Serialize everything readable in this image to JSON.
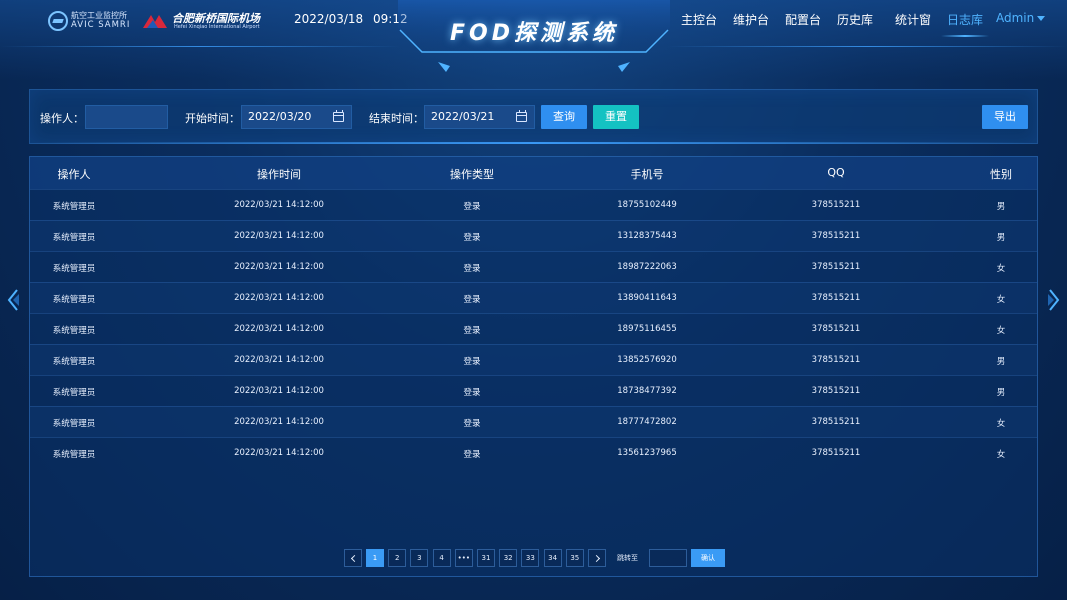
{
  "header": {
    "logo1": {
      "cn": "航空工业监控所",
      "en": "AVIC  SAMRI"
    },
    "logo2": {
      "cn": "合肥新桥国际机场",
      "en": "Hefei Xinqiao International Airport"
    },
    "date": "2022/03/18",
    "time": "09:12",
    "title": "FOD探测系统",
    "nav": [
      "主控台",
      "维护台",
      "配置台",
      "历史库",
      "统计窗",
      "日志库"
    ],
    "active_nav": "日志库",
    "user": "Admin"
  },
  "filter": {
    "operator_label": "操作人：",
    "operator_value": "",
    "start_label": "开始时间：",
    "start_value": "2022/03/20",
    "end_label": "结束时间：",
    "end_value": "2022/03/21",
    "query_label": "查询",
    "reset_label": "重置",
    "export_label": "导出"
  },
  "table": {
    "columns": [
      "操作人",
      "操作时间",
      "操作类型",
      "手机号",
      "QQ",
      "性别"
    ],
    "rows": [
      [
        "系统管理员",
        "2022/03/21  14:12:00",
        "登录",
        "18755102449",
        "378515211",
        "男"
      ],
      [
        "系统管理员",
        "2022/03/21  14:12:00",
        "登录",
        "13128375443",
        "378515211",
        "男"
      ],
      [
        "系统管理员",
        "2022/03/21  14:12:00",
        "登录",
        "18987222063",
        "378515211",
        "女"
      ],
      [
        "系统管理员",
        "2022/03/21  14:12:00",
        "登录",
        "13890411643",
        "378515211",
        "女"
      ],
      [
        "系统管理员",
        "2022/03/21  14:12:00",
        "登录",
        "18975116455",
        "378515211",
        "女"
      ],
      [
        "系统管理员",
        "2022/03/21  14:12:00",
        "登录",
        "13852576920",
        "378515211",
        "男"
      ],
      [
        "系统管理员",
        "2022/03/21  14:12:00",
        "登录",
        "18738477392",
        "378515211",
        "男"
      ],
      [
        "系统管理员",
        "2022/03/21  14:12:00",
        "登录",
        "18777472802",
        "378515211",
        "女"
      ],
      [
        "系统管理员",
        "2022/03/21  14:12:00",
        "登录",
        "13561237965",
        "378515211",
        "女"
      ]
    ]
  },
  "pagination": {
    "pages": [
      "1",
      "2",
      "3",
      "4",
      "•••",
      "31",
      "32",
      "33",
      "34",
      "35"
    ],
    "current": "1",
    "jump_label": "跳转至",
    "jump_value": "",
    "confirm_label": "确认"
  },
  "colors": {
    "accent": "#2f8ff0",
    "reset": "#14c2c2",
    "active_nav": "#4fb3ff",
    "background": "#0a2d5e"
  },
  "icons": [
    "calendar-icon",
    "chevron-left-icon",
    "chevron-right-icon",
    "caret-down-icon",
    "side-arrow-left-icon",
    "side-arrow-right-icon"
  ]
}
